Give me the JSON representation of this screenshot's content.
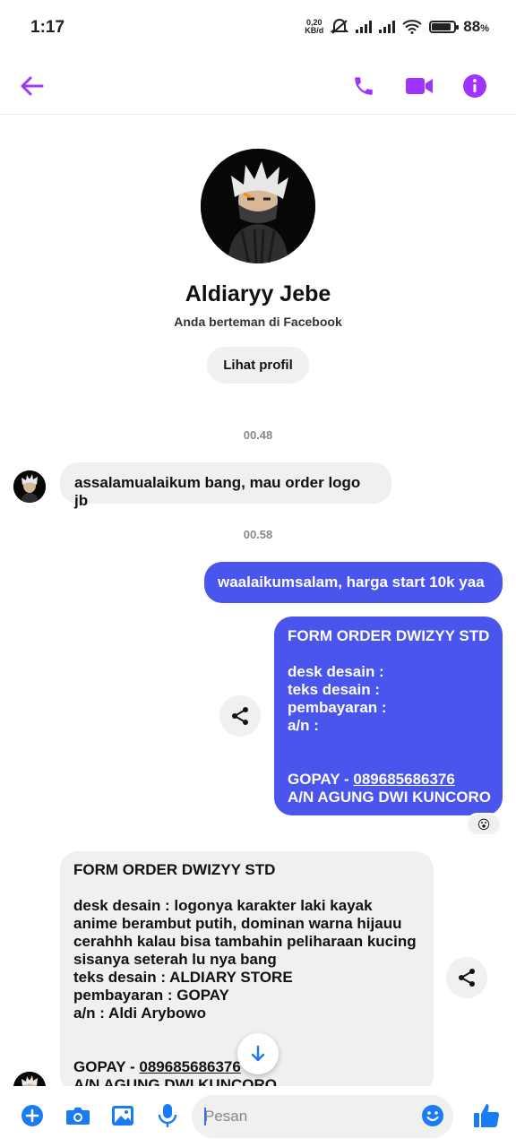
{
  "status": {
    "time": "1:17",
    "net_speed_top": "0,20",
    "net_speed_bottom": "KB/d",
    "battery_pct": "88",
    "battery_unit": "%",
    "battery_level": 0.88
  },
  "header": {
    "back_icon": "arrow-left-icon",
    "call_icon": "phone-icon",
    "video_icon": "video-camera-icon",
    "info_icon": "info-icon",
    "accent": "#a033ff"
  },
  "profile": {
    "name": "Aldiaryy Jebe",
    "subtitle": "Anda berteman di Facebook",
    "view_profile_label": "Lihat profil"
  },
  "messages": {
    "ts1": "00.48",
    "msg1": "assalamualaikum bang, mau order logo jb",
    "ts2": "00.58",
    "msg2": "waalaikumsalam, harga start 10k yaa",
    "form_out": {
      "title": "FORM ORDER DWIZYY STD",
      "desk": "desk desain :",
      "teks": "teks desain :",
      "bayar": "pembayaran :",
      "an": "a/n :",
      "gopay_prefix": "GOPAY - ",
      "gopay_number": "089685686376",
      "an_name": "A/N AGUNG DWI KUNCORO",
      "reaction": "😮"
    },
    "form_in": {
      "title": "FORM ORDER DWIZYY STD",
      "desk_1": "desk desain : logonya karakter laki kayak",
      "desk_2": "anime berambut putih, dominan warna hijauu",
      "desk_3": "cerahhh kalau bisa tambahin peliharaan kucing",
      "desk_4": "sisanya seterah lu nya bang",
      "teks": "teks desain : ALDIARY STORE",
      "bayar": "pembayaran : GOPAY",
      "an": "a/n : Aldi Arybowo",
      "gopay_prefix": "GOPAY - ",
      "gopay_number": "089685686376",
      "an_name": "A/N AGUNG DWI KUNCORO"
    },
    "outgoing_color": "#4a55ee",
    "incoming_color": "#f0f0f0"
  },
  "composer": {
    "placeholder": "Pesan",
    "icons": [
      "plus-icon",
      "camera-icon",
      "image-icon",
      "microphone-icon",
      "emoji-icon",
      "thumbs-up-icon"
    ],
    "accent": "#1a7cf5"
  }
}
